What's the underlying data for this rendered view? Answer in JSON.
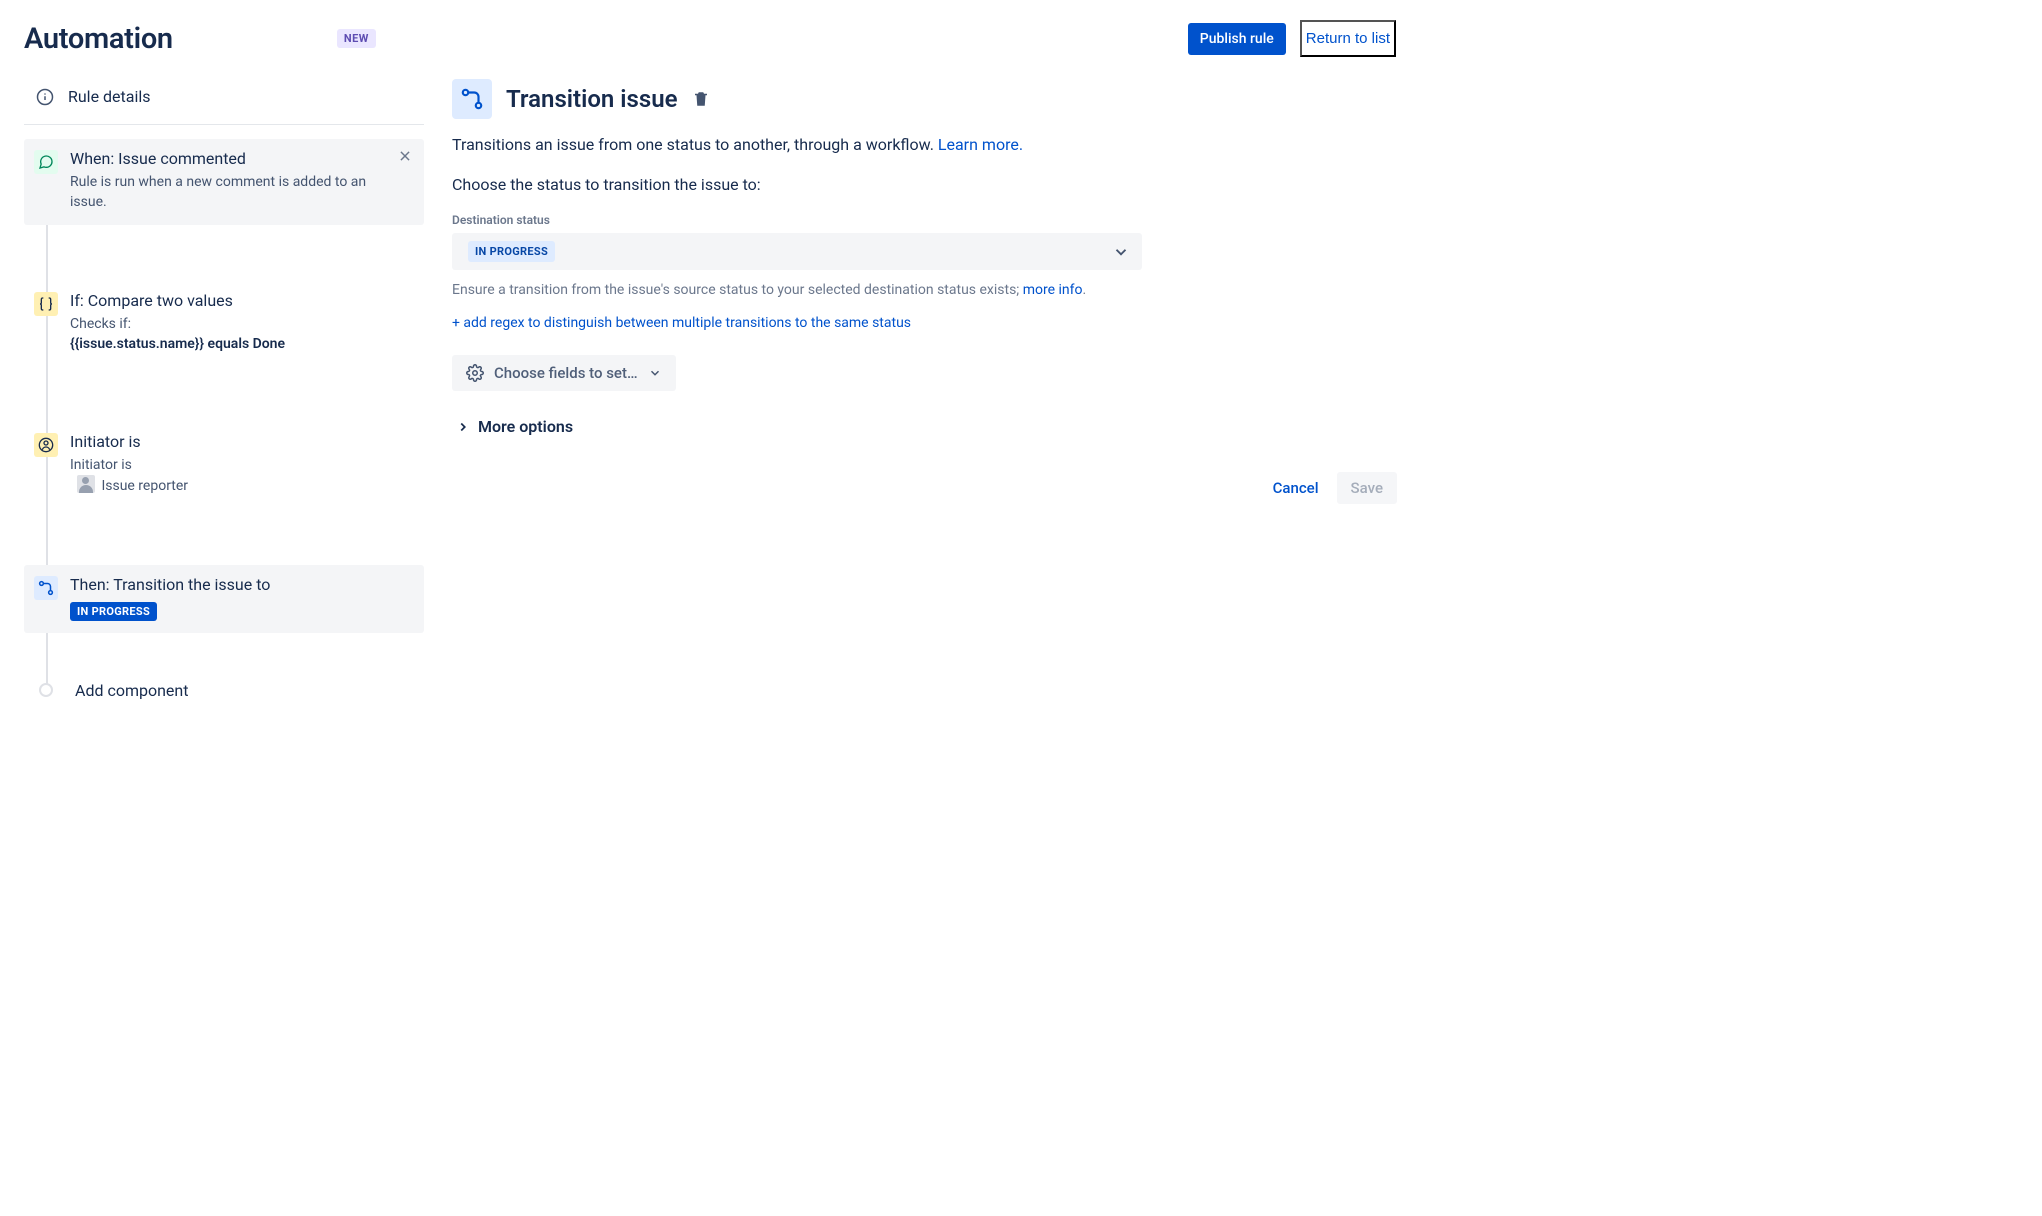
{
  "header": {
    "title": "Automation",
    "badge": "NEW",
    "publish": "Publish rule",
    "return": "Return to list"
  },
  "sidebar": {
    "rule_details": "Rule details",
    "steps": [
      {
        "title": "When: Issue commented",
        "desc": "Rule is run when a new comment is added to an issue."
      },
      {
        "title": "If: Compare two values",
        "desc_pre": "Checks if:",
        "desc_strong": "{{issue.status.name}} equals Done"
      },
      {
        "title": "Initiator is",
        "desc_pre": "Initiator is",
        "desc_user": "Issue reporter"
      },
      {
        "title": "Then: Transition the issue to",
        "badge": "IN PROGRESS"
      }
    ],
    "add_component": "Add component"
  },
  "panel": {
    "title": "Transition issue",
    "intro_text": "Transitions an issue from one status to another, through a workflow. ",
    "learn_more": "Learn more.",
    "choose_status": "Choose the status to transition the issue to:",
    "dest_label": "Destination status",
    "dest_value": "IN PROGRESS",
    "help_pre": "Ensure a transition from the issue's source status to your selected destination status exists; ",
    "help_link": "more info",
    "regex_link": "+ add regex to distinguish between multiple transitions to the same status",
    "fields_btn": "Choose fields to set…",
    "more_options": "More options",
    "cancel": "Cancel",
    "save": "Save"
  }
}
